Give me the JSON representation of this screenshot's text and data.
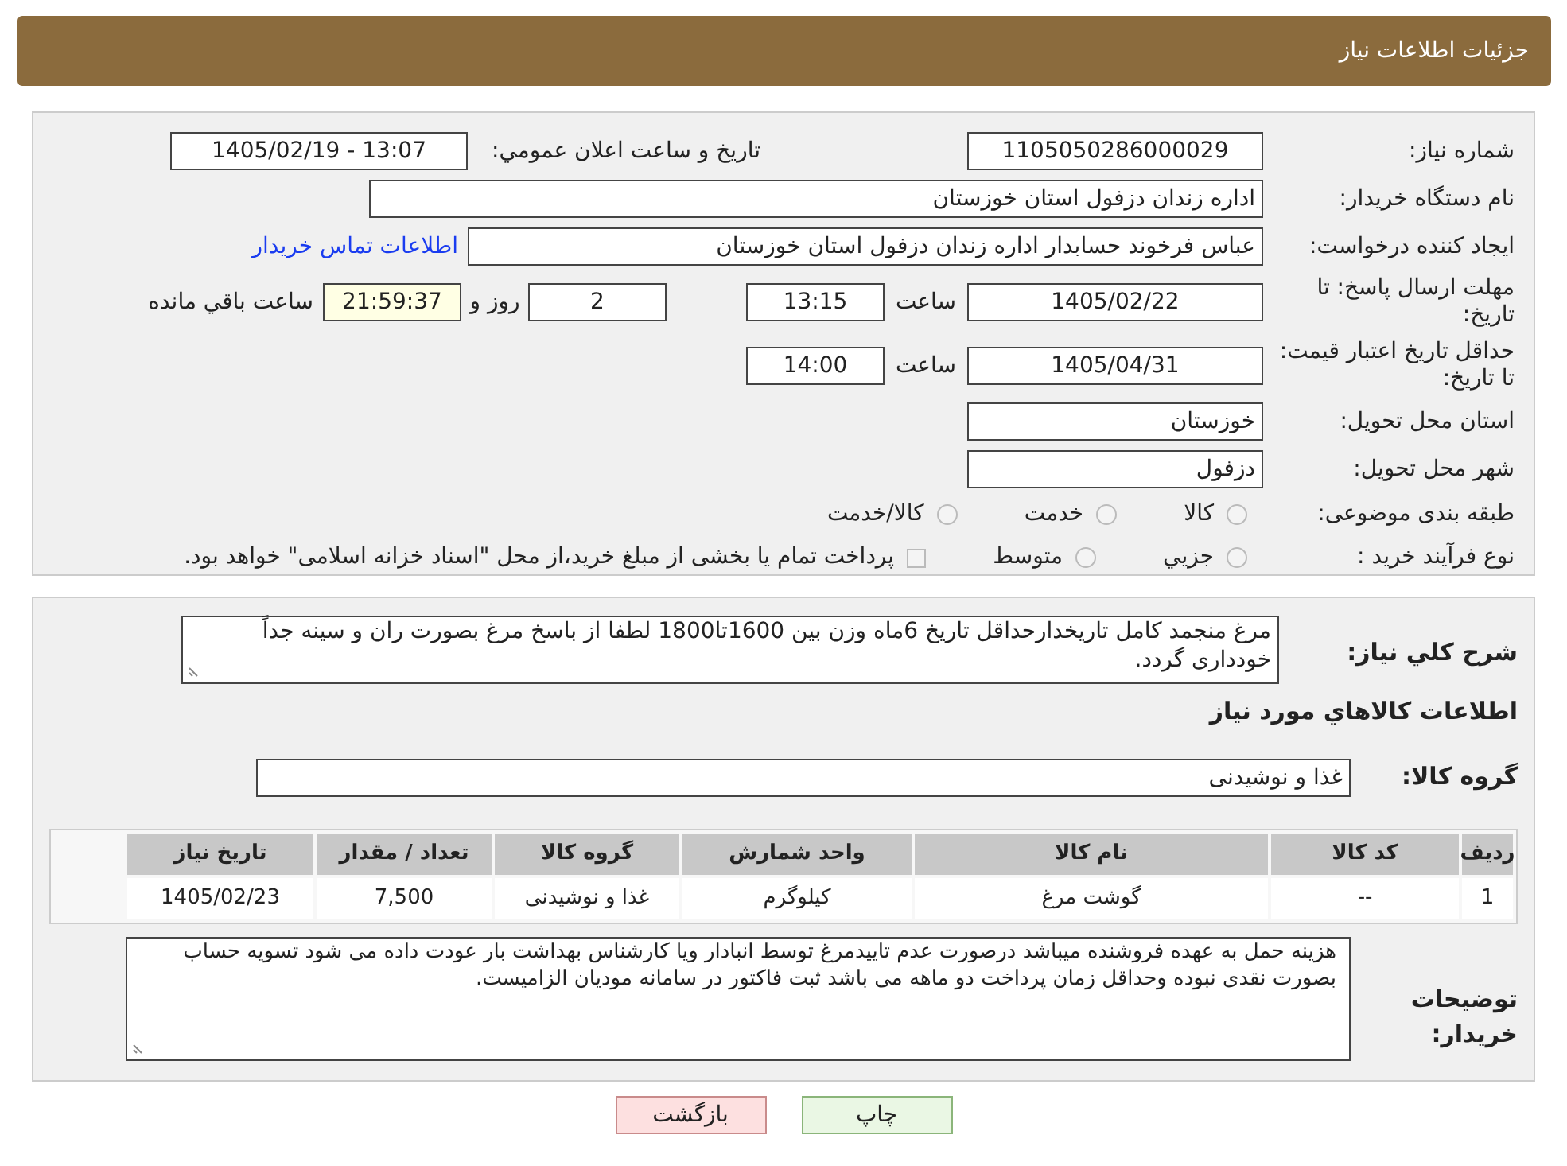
{
  "header": {
    "title": "جزئیات اطلاعات نیاز"
  },
  "need_number": {
    "label": "شماره نیاز:",
    "value": "1105050286000029"
  },
  "announce": {
    "label": "تاريخ و ساعت اعلان عمومي:",
    "value": "1405/02/19 - 13:07"
  },
  "buyer_org": {
    "label": "نام دستگاه خريدار:",
    "value": "اداره زندان دزفول استان خوزستان"
  },
  "requester": {
    "label": "ايجاد کننده درخواست:",
    "value": "عباس فرخوند حسابدار اداره زندان دزفول استان خوزستان",
    "link": "اطلاعات تماس خريدار"
  },
  "reply_deadline": {
    "label": "مهلت ارسال پاسخ: تا تاریخ:",
    "date": "1405/02/22",
    "time_label": "ساعت",
    "time": "13:15",
    "days": "2",
    "days_label": "روز و",
    "remaining": "21:59:37",
    "remaining_label": "ساعت باقي مانده"
  },
  "price_validity": {
    "label": "حداقل تاريخ اعتبار قيمت: تا تاریخ:",
    "date": "1405/04/31",
    "time_label": "ساعت",
    "time": "14:00"
  },
  "province": {
    "label": "استان محل تحويل:",
    "value": "خوزستان"
  },
  "city": {
    "label": "شهر محل تحويل:",
    "value": "دزفول"
  },
  "category": {
    "label": "طبقه بندی موضوعی:",
    "options": [
      {
        "label": "کالا",
        "selected": false
      },
      {
        "label": "خدمت",
        "selected": false
      },
      {
        "label": "کالا/خدمت",
        "selected": false
      }
    ]
  },
  "purchase_type": {
    "label": "نوع فرآيند خريد :",
    "options": [
      {
        "label": "جزيي",
        "selected": false
      },
      {
        "label": "متوسط",
        "selected": false
      }
    ],
    "payment_note": {
      "label": "پرداخت تمام يا بخشی از مبلغ خريد،از محل \"اسناد خزانه اسلامی\" خواهد بود.",
      "checked": false
    }
  },
  "description": {
    "label": "شرح کلي نياز:",
    "value": "مرغ منجمد کامل تاریخدارحداقل تاریخ 6ماه وزن بین 1600تا1800 لطفا از باسخ مرغ بصورت ران و سینه جداً خودداری گردد."
  },
  "goods_title": "اطلاعات کالاهاي مورد نياز",
  "goods_group": {
    "label": "گروه کالا:",
    "value": "غذا و نوشیدنی"
  },
  "table": {
    "columns": [
      "رديف",
      "کد کالا",
      "نام کالا",
      "واحد شمارش",
      "گروه کالا",
      "تعداد / مقدار",
      "تاریخ نیاز"
    ],
    "rows": [
      [
        "1",
        "--",
        "گوشت مرغ",
        "کیلوگرم",
        "غذا و نوشیدنی",
        "7,500",
        "1405/02/23"
      ]
    ]
  },
  "buyer_notes": {
    "label": "توضيحات خريدار:",
    "value": "هزینه حمل به عهده فروشنده میباشد درصورت عدم تاییدمرغ توسط انبادار ویا کارشناس بهداشت بار عودت داده می شود تسویه حساب بصورت نقدی نبوده وحداقل زمان پرداخت دو ماهه می باشد ثبت فاکتور  در سامانه مودیان الزامیست."
  },
  "buttons": [
    {
      "label": "چاپ",
      "kind": "print"
    },
    {
      "label": "بازگشت",
      "kind": "back"
    }
  ]
}
